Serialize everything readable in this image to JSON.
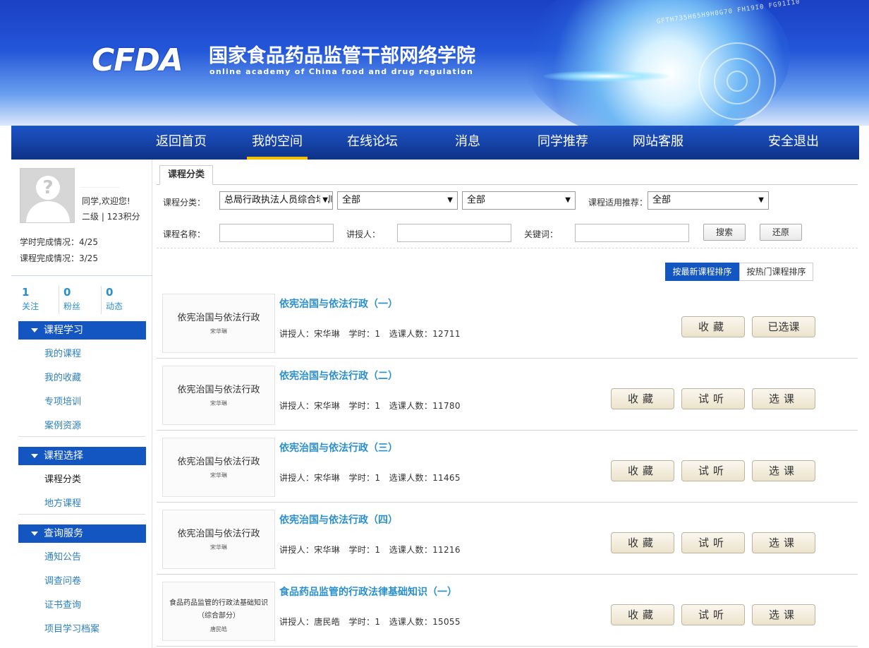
{
  "header": {
    "logo": "CFDA",
    "title": "国家食品药品监管干部网络学院",
    "subtitle": "online academy of China food and drug regulation",
    "decor_digits": "GFTH735H65H9H0G70 FH19I0 FG91I10"
  },
  "nav": {
    "items": [
      {
        "label": "返回首页"
      },
      {
        "label": "我的空间"
      },
      {
        "label": "在线论坛"
      },
      {
        "label": "消息"
      },
      {
        "label": "同学推荐"
      },
      {
        "label": "网站客服"
      },
      {
        "label": "安全退出"
      }
    ],
    "active": "我的空间"
  },
  "profile": {
    "welcome": "同学,欢迎您!",
    "level": "二级 | 123积分",
    "hours_progress": "学时完成情况：4/25",
    "course_progress": "课程完成情况：3/25",
    "stats": [
      {
        "num": "1",
        "label": "关注"
      },
      {
        "num": "0",
        "label": "粉丝"
      },
      {
        "num": "0",
        "label": "动态"
      }
    ]
  },
  "sidebar": {
    "sections": [
      {
        "title": "课程学习",
        "items": [
          "我的课程",
          "我的收藏",
          "专项培训",
          "案例资源"
        ]
      },
      {
        "title": "课程选择",
        "items": [
          "课程分类",
          "地方课程"
        ]
      },
      {
        "title": "查询服务",
        "items": [
          "通知公告",
          "调查问卷",
          "证书查询",
          "项目学习档案"
        ]
      }
    ],
    "current": "课程分类"
  },
  "filter": {
    "tab": "课程分类",
    "category_label": "课程分类：",
    "category_value": "总局行政执法人员综合培训",
    "sub1_value": "全部",
    "sub2_value": "全部",
    "recommend_label": "课程适用推荐：",
    "recommend_value": "全部",
    "name_label": "课程名称：",
    "lecturer_label": "讲授人：",
    "keyword_label": "关键词：",
    "search_button": "搜索",
    "reset_button": "还原"
  },
  "sort": {
    "newest": "按最新课程排序",
    "hottest": "按热门课程排序"
  },
  "courses": [
    {
      "thumb_title": "依宪治国与依法行政",
      "thumb_author": "宋华琳",
      "title": "依宪治国与依法行政（一）",
      "meta": "讲授人：宋华琳   学时：1   选课人数：12711",
      "buttons": [
        "收藏",
        "已选课"
      ]
    },
    {
      "thumb_title": "依宪治国与依法行政",
      "thumb_author": "宋华琳",
      "title": "依宪治国与依法行政（二）",
      "meta": "讲授人：宋华琳   学时：1   选课人数：11780",
      "buttons": [
        "收藏",
        "试听",
        "选课"
      ]
    },
    {
      "thumb_title": "依宪治国与依法行政",
      "thumb_author": "宋华琳",
      "title": "依宪治国与依法行政（三）",
      "meta": "讲授人：宋华琳   学时：1   选课人数：11465",
      "buttons": [
        "收藏",
        "试听",
        "选课"
      ]
    },
    {
      "thumb_title": "依宪治国与依法行政",
      "thumb_author": "宋华琳",
      "title": "依宪治国与依法行政（四）",
      "meta": "讲授人：宋华琳   学时：1   选课人数：11216",
      "buttons": [
        "收藏",
        "试听",
        "选课"
      ]
    },
    {
      "thumb_title": "食品药品监管的行政法基础知识",
      "thumb_title2": "（综合部分）",
      "thumb_author": "唐民皓",
      "title": "食品药品监管的行政法律基础知识（一）",
      "meta": "讲授人：唐民皓   学时：1   选课人数：15055",
      "buttons": [
        "收藏",
        "试听",
        "选课"
      ]
    }
  ],
  "colors": {
    "nav": "#1542a6",
    "accent": "#1356c2",
    "link": "#2a8fcf",
    "active_underline": "#f5c000"
  }
}
